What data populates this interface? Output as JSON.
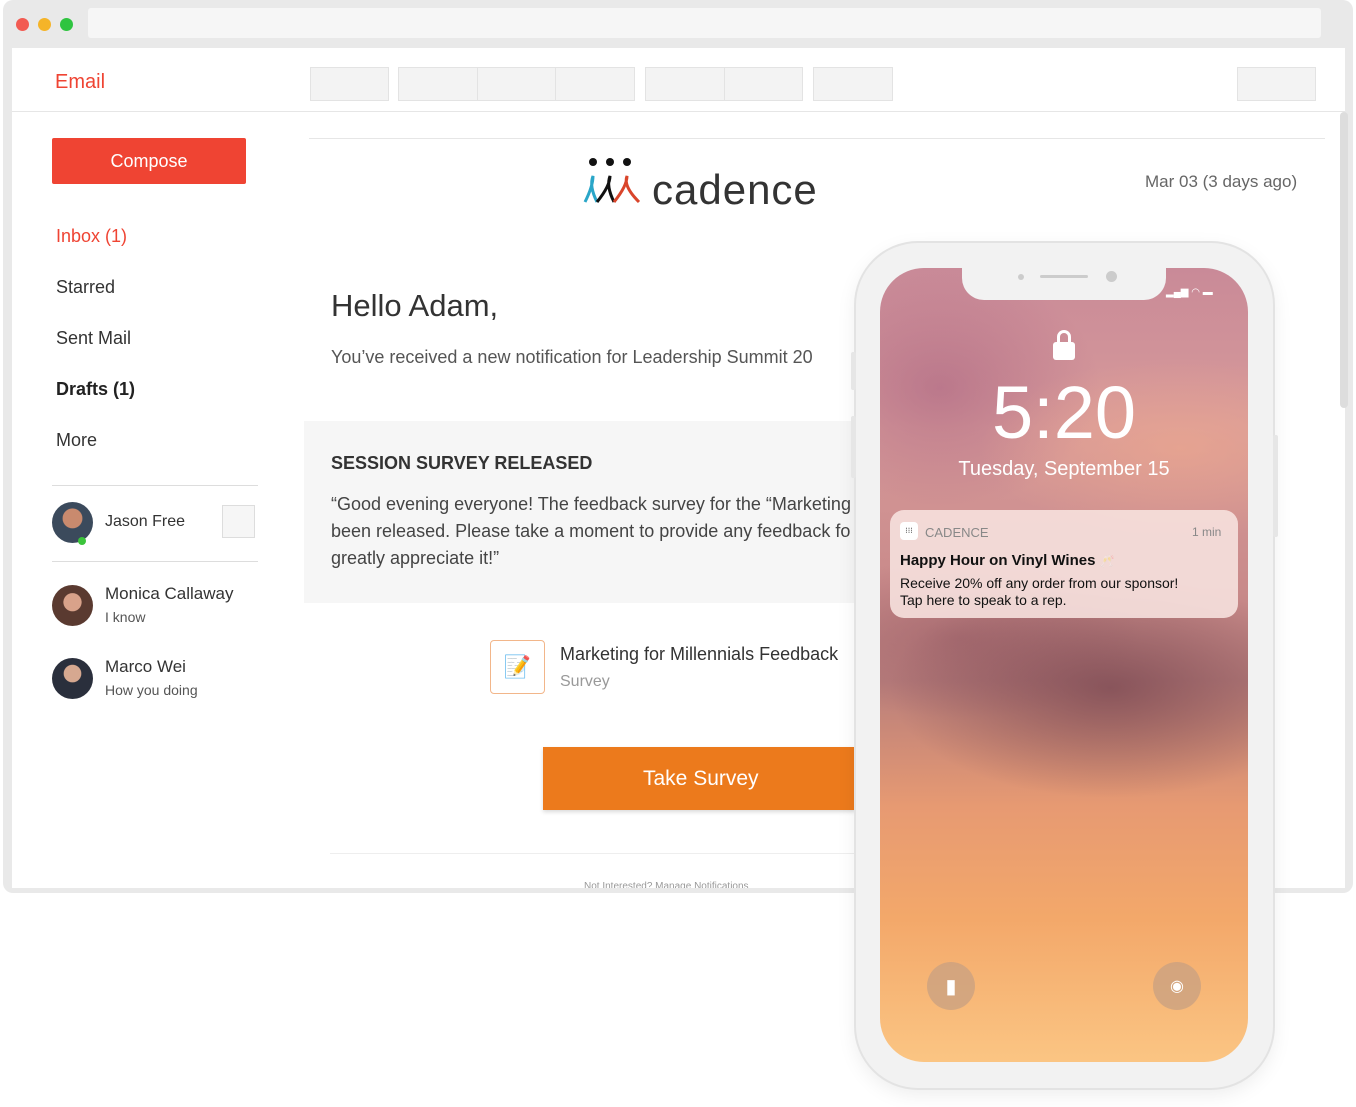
{
  "app": {
    "title": "Email"
  },
  "sidebar": {
    "compose": "Compose",
    "items": [
      {
        "label": "Inbox (1)"
      },
      {
        "label": "Starred"
      },
      {
        "label": "Sent Mail"
      },
      {
        "label": "Drafts (1)"
      },
      {
        "label": "More"
      }
    ]
  },
  "contacts": [
    {
      "name": "Jason Free",
      "status": "online"
    },
    {
      "name": "Monica Callaway",
      "sub": "I know"
    },
    {
      "name": "Marco Wei",
      "sub": "How you doing"
    }
  ],
  "email": {
    "brand": "cadence",
    "date": "Mar 03 (3 days ago)",
    "greeting": "Hello Adam,",
    "intro": "You’ve received a new notification for Leadership Summit 20",
    "box_title": "SESSION SURVEY RELEASED",
    "box_lines": [
      "“Good evening everyone! The feedback survey for the “Marketing",
      "been released. Please take a moment to provide any feedback fo",
      "greatly appreciate it!”"
    ],
    "survey_title": "Marketing for Millennials Feedback",
    "survey_sub": "Survey",
    "cta": "Take Survey",
    "footer": "Not Interested? Manage Notifications"
  },
  "phone": {
    "time": "5:20",
    "date": "Tuesday, September 15",
    "notification": {
      "app": "CADENCE",
      "age": "1 min",
      "title": "Happy Hour on Vinyl Wines",
      "emoji": "🥂",
      "body1": "Receive 20% off any order from our sponsor!",
      "body2": "Tap here to speak to a rep."
    }
  },
  "colors": {
    "accent": "#ef4433",
    "cta": "#ec7a1c"
  }
}
